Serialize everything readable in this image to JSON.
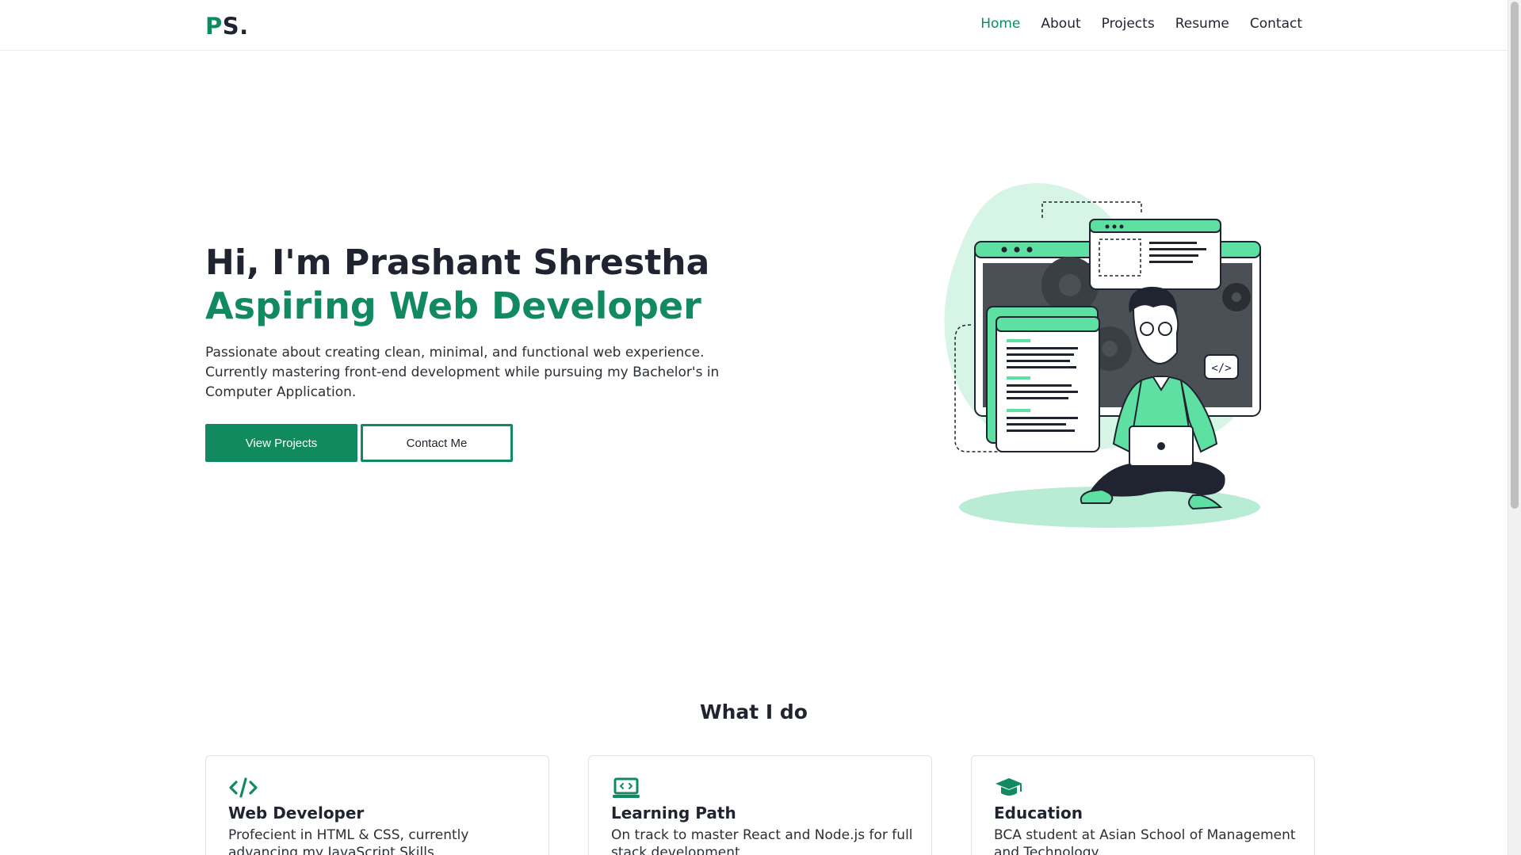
{
  "brand": {
    "logo_first": "P",
    "logo_rest": "S.",
    "accent_color": "#128a5f"
  },
  "nav": {
    "items": [
      {
        "label": "Home",
        "active": true
      },
      {
        "label": "About",
        "active": false
      },
      {
        "label": "Projects",
        "active": false
      },
      {
        "label": "Resume",
        "active": false
      },
      {
        "label": "Contact",
        "active": false
      }
    ]
  },
  "hero": {
    "title": "Hi, I'm Prashant Shrestha",
    "subtitle": "Aspiring Web Developer",
    "description": "Passionate about creating clean, minimal, and functional web experience. Currently mastering front-end development while pursuing my Bachelor's in Computer Application.",
    "primary_button": "View Projects",
    "secondary_button": "Contact Me",
    "illustration": "developer-with-laptop-illustration"
  },
  "services": {
    "title": "What I do",
    "cards": [
      {
        "icon": "code-icon",
        "title": "Web Developer",
        "text": "Profecient in HTML & CSS, currently advancing my JavaScript Skills"
      },
      {
        "icon": "laptop-code-icon",
        "title": "Learning Path",
        "text": "On track to master React and Node.js for full stack development"
      },
      {
        "icon": "graduation-cap-icon",
        "title": "Education",
        "text": "BCA student at Asian School of Management and Technology"
      }
    ]
  }
}
